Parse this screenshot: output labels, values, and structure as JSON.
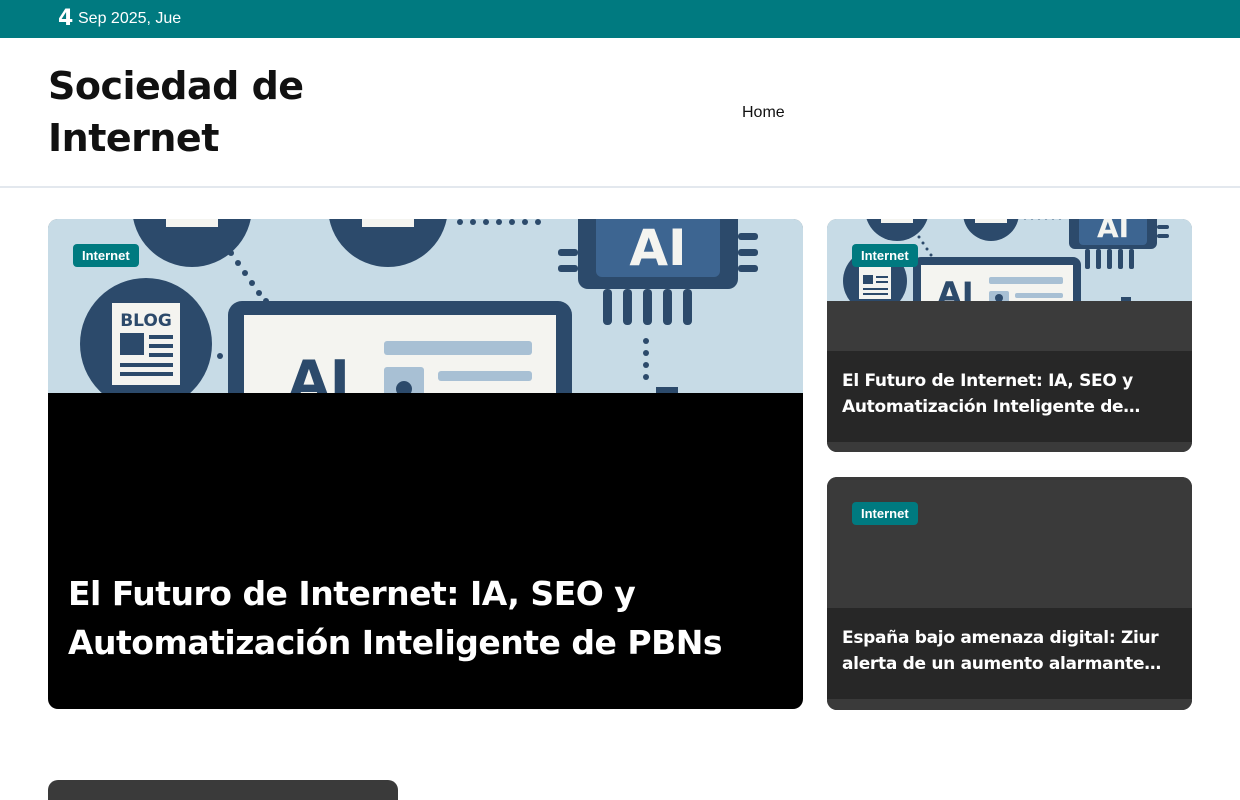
{
  "topbar": {
    "day": "4",
    "date": "Sep 2025, Jue"
  },
  "header": {
    "site_title": "Sociedad de Internet",
    "nav": {
      "home": "Home"
    }
  },
  "featured": {
    "category": "Internet",
    "title": "El Futuro de Internet: IA, SEO y Automatización Inteligente de PBNs",
    "image_labels": {
      "blog": "BLOG",
      "ai": "AI"
    }
  },
  "side_posts": [
    {
      "category": "Internet",
      "title": "El Futuro de Internet: IA, SEO y Automatización Inteligente de PBNs",
      "image_labels": {
        "ai": "AI"
      }
    },
    {
      "category": "Internet",
      "title": "España bajo amenaza digital: Ziur alerta de un aumento alarmante d..."
    }
  ],
  "colors": {
    "accent": "#007a80",
    "card_dark": "#272727",
    "card_mid": "#3a3a3a",
    "illustration_bg": "#c7dbe6",
    "illustration_navy": "#2c4a6b"
  },
  "icons": [
    "blog-document-icon",
    "ai-chip-icon",
    "monitor-icon"
  ]
}
